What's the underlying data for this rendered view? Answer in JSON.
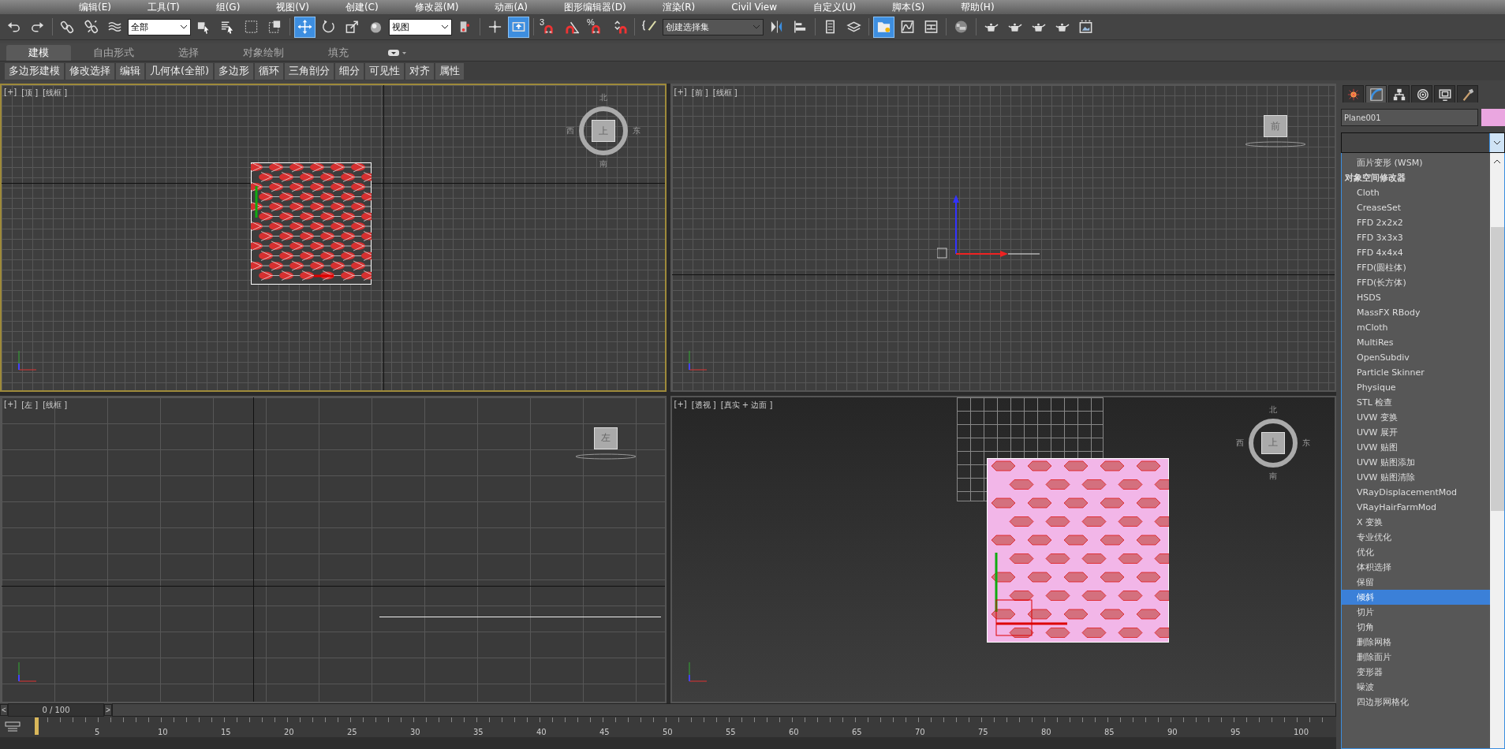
{
  "menu": [
    {
      "label": "编辑(E)"
    },
    {
      "label": "工具(T)"
    },
    {
      "label": "组(G)"
    },
    {
      "label": "视图(V)"
    },
    {
      "label": "创建(C)"
    },
    {
      "label": "修改器(M)"
    },
    {
      "label": "动画(A)"
    },
    {
      "label": "图形编辑器(D)"
    },
    {
      "label": "渲染(R)"
    },
    {
      "label": "Civil View"
    },
    {
      "label": "自定义(U)"
    },
    {
      "label": "脚本(S)"
    },
    {
      "label": "帮助(H)"
    }
  ],
  "toolbar": [
    {
      "kind": "undo",
      "active": false
    },
    {
      "kind": "redo",
      "active": false
    },
    {
      "kind": "sep"
    },
    {
      "kind": "link",
      "active": false
    },
    {
      "kind": "unlink",
      "active": false
    },
    {
      "kind": "bind",
      "active": false
    },
    {
      "kind": "dropdown",
      "value": "全部"
    },
    {
      "kind": "select",
      "active": false
    },
    {
      "kind": "select-name",
      "active": false
    },
    {
      "kind": "region",
      "active": false
    },
    {
      "kind": "crossing",
      "active": false
    },
    {
      "kind": "sep"
    },
    {
      "kind": "move",
      "active": true
    },
    {
      "kind": "rotate",
      "active": false
    },
    {
      "kind": "scale",
      "active": false
    },
    {
      "kind": "placement",
      "active": false
    },
    {
      "kind": "dropdown",
      "value": "视图"
    },
    {
      "kind": "pivot",
      "active": false
    },
    {
      "kind": "sep"
    },
    {
      "kind": "manipulate",
      "active": false
    },
    {
      "kind": "keyboard",
      "active": true
    },
    {
      "kind": "sep"
    },
    {
      "kind": "snap",
      "active": false,
      "badge": "3"
    },
    {
      "kind": "angle-snap",
      "active": false
    },
    {
      "kind": "snap",
      "active": false,
      "badge": "%"
    },
    {
      "kind": "spinner-snap",
      "active": false
    },
    {
      "kind": "sep"
    },
    {
      "kind": "edit-named",
      "active": false
    },
    {
      "kind": "named-set",
      "value": "创建选择集"
    },
    {
      "kind": "mirror",
      "active": false
    },
    {
      "kind": "align",
      "active": false
    },
    {
      "kind": "sep"
    },
    {
      "kind": "list",
      "active": false
    },
    {
      "kind": "layers",
      "active": false
    },
    {
      "kind": "sep"
    },
    {
      "kind": "explorer",
      "active": true
    },
    {
      "kind": "curve",
      "active": false
    },
    {
      "kind": "schematic",
      "active": false
    },
    {
      "kind": "sep"
    },
    {
      "kind": "material",
      "active": false
    },
    {
      "kind": "sep"
    },
    {
      "kind": "teapot",
      "active": false
    },
    {
      "kind": "teapot",
      "active": false
    },
    {
      "kind": "teapot",
      "active": false
    },
    {
      "kind": "teapot",
      "active": false
    },
    {
      "kind": "frame-window",
      "active": false
    }
  ],
  "ribbon": {
    "tabs": [
      {
        "label": "建模",
        "selected": true
      },
      {
        "label": "自由形式",
        "selected": false
      },
      {
        "label": "选择",
        "selected": false
      },
      {
        "label": "对象绘制",
        "selected": false
      },
      {
        "label": "填充",
        "selected": false
      }
    ],
    "buttons": [
      "多边形建模",
      "修改选择",
      "编辑",
      "几何体(全部)",
      "多边形",
      "循环",
      "三角剖分",
      "细分",
      "可见性",
      "对齐",
      "属性"
    ]
  },
  "viewports": [
    {
      "labels": [
        "[+]",
        "[顶 ]",
        "[线框 ]"
      ],
      "active": true,
      "kind": "top",
      "cube": "上",
      "compass": [
        "北",
        "西",
        "东",
        "南"
      ]
    },
    {
      "labels": [
        "[+]",
        "[前 ]",
        "[线框 ]"
      ],
      "active": false,
      "kind": "front",
      "cube": "前"
    },
    {
      "labels": [
        "[+]",
        "[左 ]",
        "[线框 ]"
      ],
      "active": false,
      "kind": "left",
      "cube": "左"
    },
    {
      "labels": [
        "[+]",
        "[透视 ]",
        "[真实 + 边面 ]"
      ],
      "active": false,
      "kind": "perspective",
      "cube": "上",
      "compass": [
        "北",
        "西",
        "东",
        "南"
      ]
    }
  ],
  "command_panel": {
    "tabs": [
      {
        "kind": "create",
        "selected": false
      },
      {
        "kind": "modify",
        "selected": true
      },
      {
        "kind": "hierarchy",
        "selected": false
      },
      {
        "kind": "motion",
        "selected": false
      },
      {
        "kind": "display",
        "selected": false
      },
      {
        "kind": "utilities",
        "selected": false
      }
    ],
    "object_name": "Plane001",
    "modifier_list": [
      {
        "label": "面片变形 (WSM)",
        "kind": "item",
        "selected": false
      },
      {
        "label": "对象空间修改器",
        "kind": "header",
        "selected": false
      },
      {
        "label": "Cloth",
        "kind": "item",
        "selected": false
      },
      {
        "label": "CreaseSet",
        "kind": "item",
        "selected": false
      },
      {
        "label": "FFD 2x2x2",
        "kind": "item",
        "selected": false
      },
      {
        "label": "FFD 3x3x3",
        "kind": "item",
        "selected": false
      },
      {
        "label": "FFD 4x4x4",
        "kind": "item",
        "selected": false
      },
      {
        "label": "FFD(圆柱体)",
        "kind": "item",
        "selected": false
      },
      {
        "label": "FFD(长方体)",
        "kind": "item",
        "selected": false
      },
      {
        "label": "HSDS",
        "kind": "item",
        "selected": false
      },
      {
        "label": "MassFX RBody",
        "kind": "item",
        "selected": false
      },
      {
        "label": "mCloth",
        "kind": "item",
        "selected": false
      },
      {
        "label": "MultiRes",
        "kind": "item",
        "selected": false
      },
      {
        "label": "OpenSubdiv",
        "kind": "item",
        "selected": false
      },
      {
        "label": "Particle Skinner",
        "kind": "item",
        "selected": false
      },
      {
        "label": "Physique",
        "kind": "item",
        "selected": false
      },
      {
        "label": "STL 检查",
        "kind": "item",
        "selected": false
      },
      {
        "label": "UVW 变换",
        "kind": "item",
        "selected": false
      },
      {
        "label": "UVW 展开",
        "kind": "item",
        "selected": false
      },
      {
        "label": "UVW 贴图",
        "kind": "item",
        "selected": false
      },
      {
        "label": "UVW 贴图添加",
        "kind": "item",
        "selected": false
      },
      {
        "label": "UVW 贴图清除",
        "kind": "item",
        "selected": false
      },
      {
        "label": "VRayDisplacementMod",
        "kind": "item",
        "selected": false
      },
      {
        "label": "VRayHairFarmMod",
        "kind": "item",
        "selected": false
      },
      {
        "label": "X 变换",
        "kind": "item",
        "selected": false
      },
      {
        "label": "专业优化",
        "kind": "item",
        "selected": false
      },
      {
        "label": "优化",
        "kind": "item",
        "selected": false
      },
      {
        "label": "体积选择",
        "kind": "item",
        "selected": false
      },
      {
        "label": "保留",
        "kind": "item",
        "selected": false
      },
      {
        "label": "倾斜",
        "kind": "item",
        "selected": true
      },
      {
        "label": "切片",
        "kind": "item",
        "selected": false
      },
      {
        "label": "切角",
        "kind": "item",
        "selected": false
      },
      {
        "label": "删除网格",
        "kind": "item",
        "selected": false
      },
      {
        "label": "删除面片",
        "kind": "item",
        "selected": false
      },
      {
        "label": "变形器",
        "kind": "item",
        "selected": false
      },
      {
        "label": "噪波",
        "kind": "item",
        "selected": false
      },
      {
        "label": "四边形网格化",
        "kind": "item",
        "selected": false
      }
    ]
  },
  "timeline": {
    "prev": "<",
    "frame": "0 / 100",
    "next": ">",
    "ticks": [
      "5",
      "10",
      "15",
      "20",
      "25",
      "30",
      "35",
      "40",
      "45",
      "50",
      "55",
      "60",
      "65",
      "70",
      "75",
      "80",
      "85",
      "90",
      "95",
      "100"
    ]
  }
}
